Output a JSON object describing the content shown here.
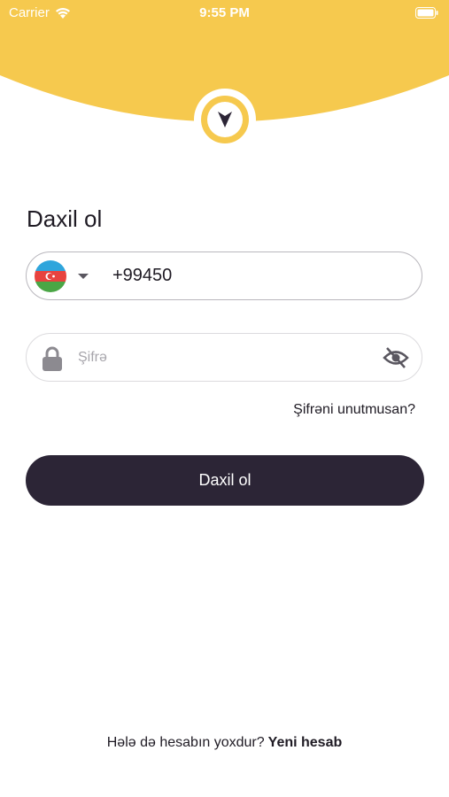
{
  "status_bar": {
    "carrier": "Carrier",
    "time": "9:55 PM",
    "wifi_icon": "wifi-icon",
    "battery_icon": "battery-icon"
  },
  "header": {
    "accent_color": "#f6c94e",
    "logo_icon": "navigation-arrow-icon"
  },
  "login": {
    "title": "Daxil ol",
    "country_flag": "azerbaijan-flag",
    "phone_value": "+99450",
    "password_placeholder": "Şifrə",
    "lock_icon": "lock-icon",
    "visibility_icon": "eye-off-icon",
    "forgot_password": "Şifrəni unutmusan?",
    "submit_label": "Daxil ol",
    "button_color": "#2c2536"
  },
  "footer": {
    "prompt": "Hələ də hesabın yoxdur?",
    "signup_link": "Yeni hesab"
  }
}
